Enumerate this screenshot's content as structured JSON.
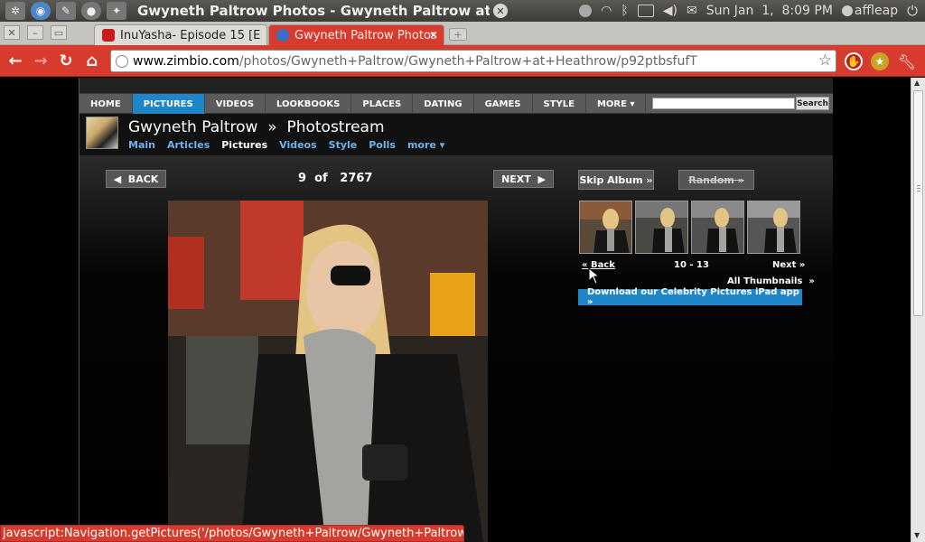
{
  "system_panel": {
    "window_title": "Gwyneth Paltrow Photos - Gwyneth Paltrow at He...",
    "datetime": "Sun Jan  1,  8:09 PM",
    "user": "affleap"
  },
  "tabs": [
    {
      "title": "InuYasha- Episode 15 [E",
      "active": false
    },
    {
      "title": "Gwyneth Paltrow Photos",
      "active": true
    }
  ],
  "toolbar": {
    "url_domain": "www.zimbio.com",
    "url_path": "/photos/Gwyneth+Paltrow/Gwyneth+Paltrow+at+Heathrow/p92ptbsfufT"
  },
  "site": {
    "menu": [
      "HOME",
      "PICTURES",
      "VIDEOS",
      "LOOKBOOKS",
      "PLACES",
      "DATING",
      "GAMES",
      "STYLE",
      "MORE ▾"
    ],
    "active_menu": "PICTURES",
    "search_button": "Search",
    "title": "Gwyneth Paltrow  »  Photostream",
    "subnav": [
      "Main",
      "Articles",
      "Pictures",
      "Videos",
      "Style",
      "Polls",
      "more ▾"
    ],
    "current_subnav": "Pictures",
    "back_label": "◀  BACK",
    "next_label": "NEXT  ▶",
    "counter_current": "9",
    "counter_of": "of",
    "counter_total": "2767",
    "skip_album": "Skip Album »",
    "random": "Random »",
    "thumbs_back": "« Back",
    "thumbs_range": "10 - 13",
    "thumbs_next": "Next »",
    "all_thumbnails": "All Thumbnails  »",
    "ipad_promo": "Download our Celebrity Pictures iPad app »"
  },
  "status_bar": "javascript:Navigation.getPictures('/photos/Gwyneth+Paltrow/Gwyneth+Paltrow"
}
